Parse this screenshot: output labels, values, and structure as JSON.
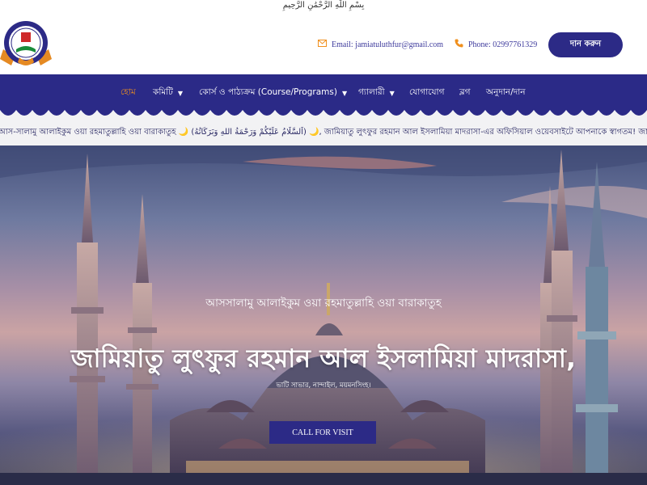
{
  "header": {
    "basmala": "بِسْمِ اللَّهِ الرَّحْمَٰنِ الرَّحِيمِ",
    "email": "Email: jamiatuluthfur@gmail.com",
    "phone": "Phone: 02997761329",
    "donate_label": "দান করুন"
  },
  "icons": {
    "email": "envelope-icon",
    "phone": "phone-icon",
    "dropdown": "chevron-down-icon"
  },
  "nav": {
    "home": "হোম",
    "committee": "কমিটি",
    "courses": "কোর্স ও পাঠ্যক্রম (Course/Programs)",
    "gallery": "গ্যালারী",
    "contact": "যোগাযোগ",
    "blog": "ব্লগ",
    "donation": "অনুদান/দান"
  },
  "ticker": {
    "text": "আস-সালামু আলাইকুম ওয়া রহমাতুল্লাহি ওয়া বারাকাতুহ 🌙 (اَلسَّلَامُ عَلَيْكُمْ وَرَحْمَةُ اللهِ وَبَرَكَاتُهُ) 🌙, জামিয়াতু লুৎফুর রহমান আল ইসলামিয়া মাদরাসা-এর অফিসিয়াল ওয়েবসাইটে আপনাকে স্বাগতম! জান্নাতের পথে"
  },
  "hero": {
    "greeting": "আসসালামু আলাইকুম ওয়া রহমাতুল্লাহি ওয়া বারাকাতুহ",
    "title": "জামিয়াতু লুৎফুর রহমান আল ইসলামিয়া মাদরাসা,",
    "subtitle": "ভাটি সাভার, নান্দাইল, ময়মনসিংহ।",
    "cta_label": "CALL FOR VISIT"
  },
  "colors": {
    "brand": "#2c2a86",
    "accent": "#f0901e",
    "ticker_bg": "#f2f2f4"
  }
}
